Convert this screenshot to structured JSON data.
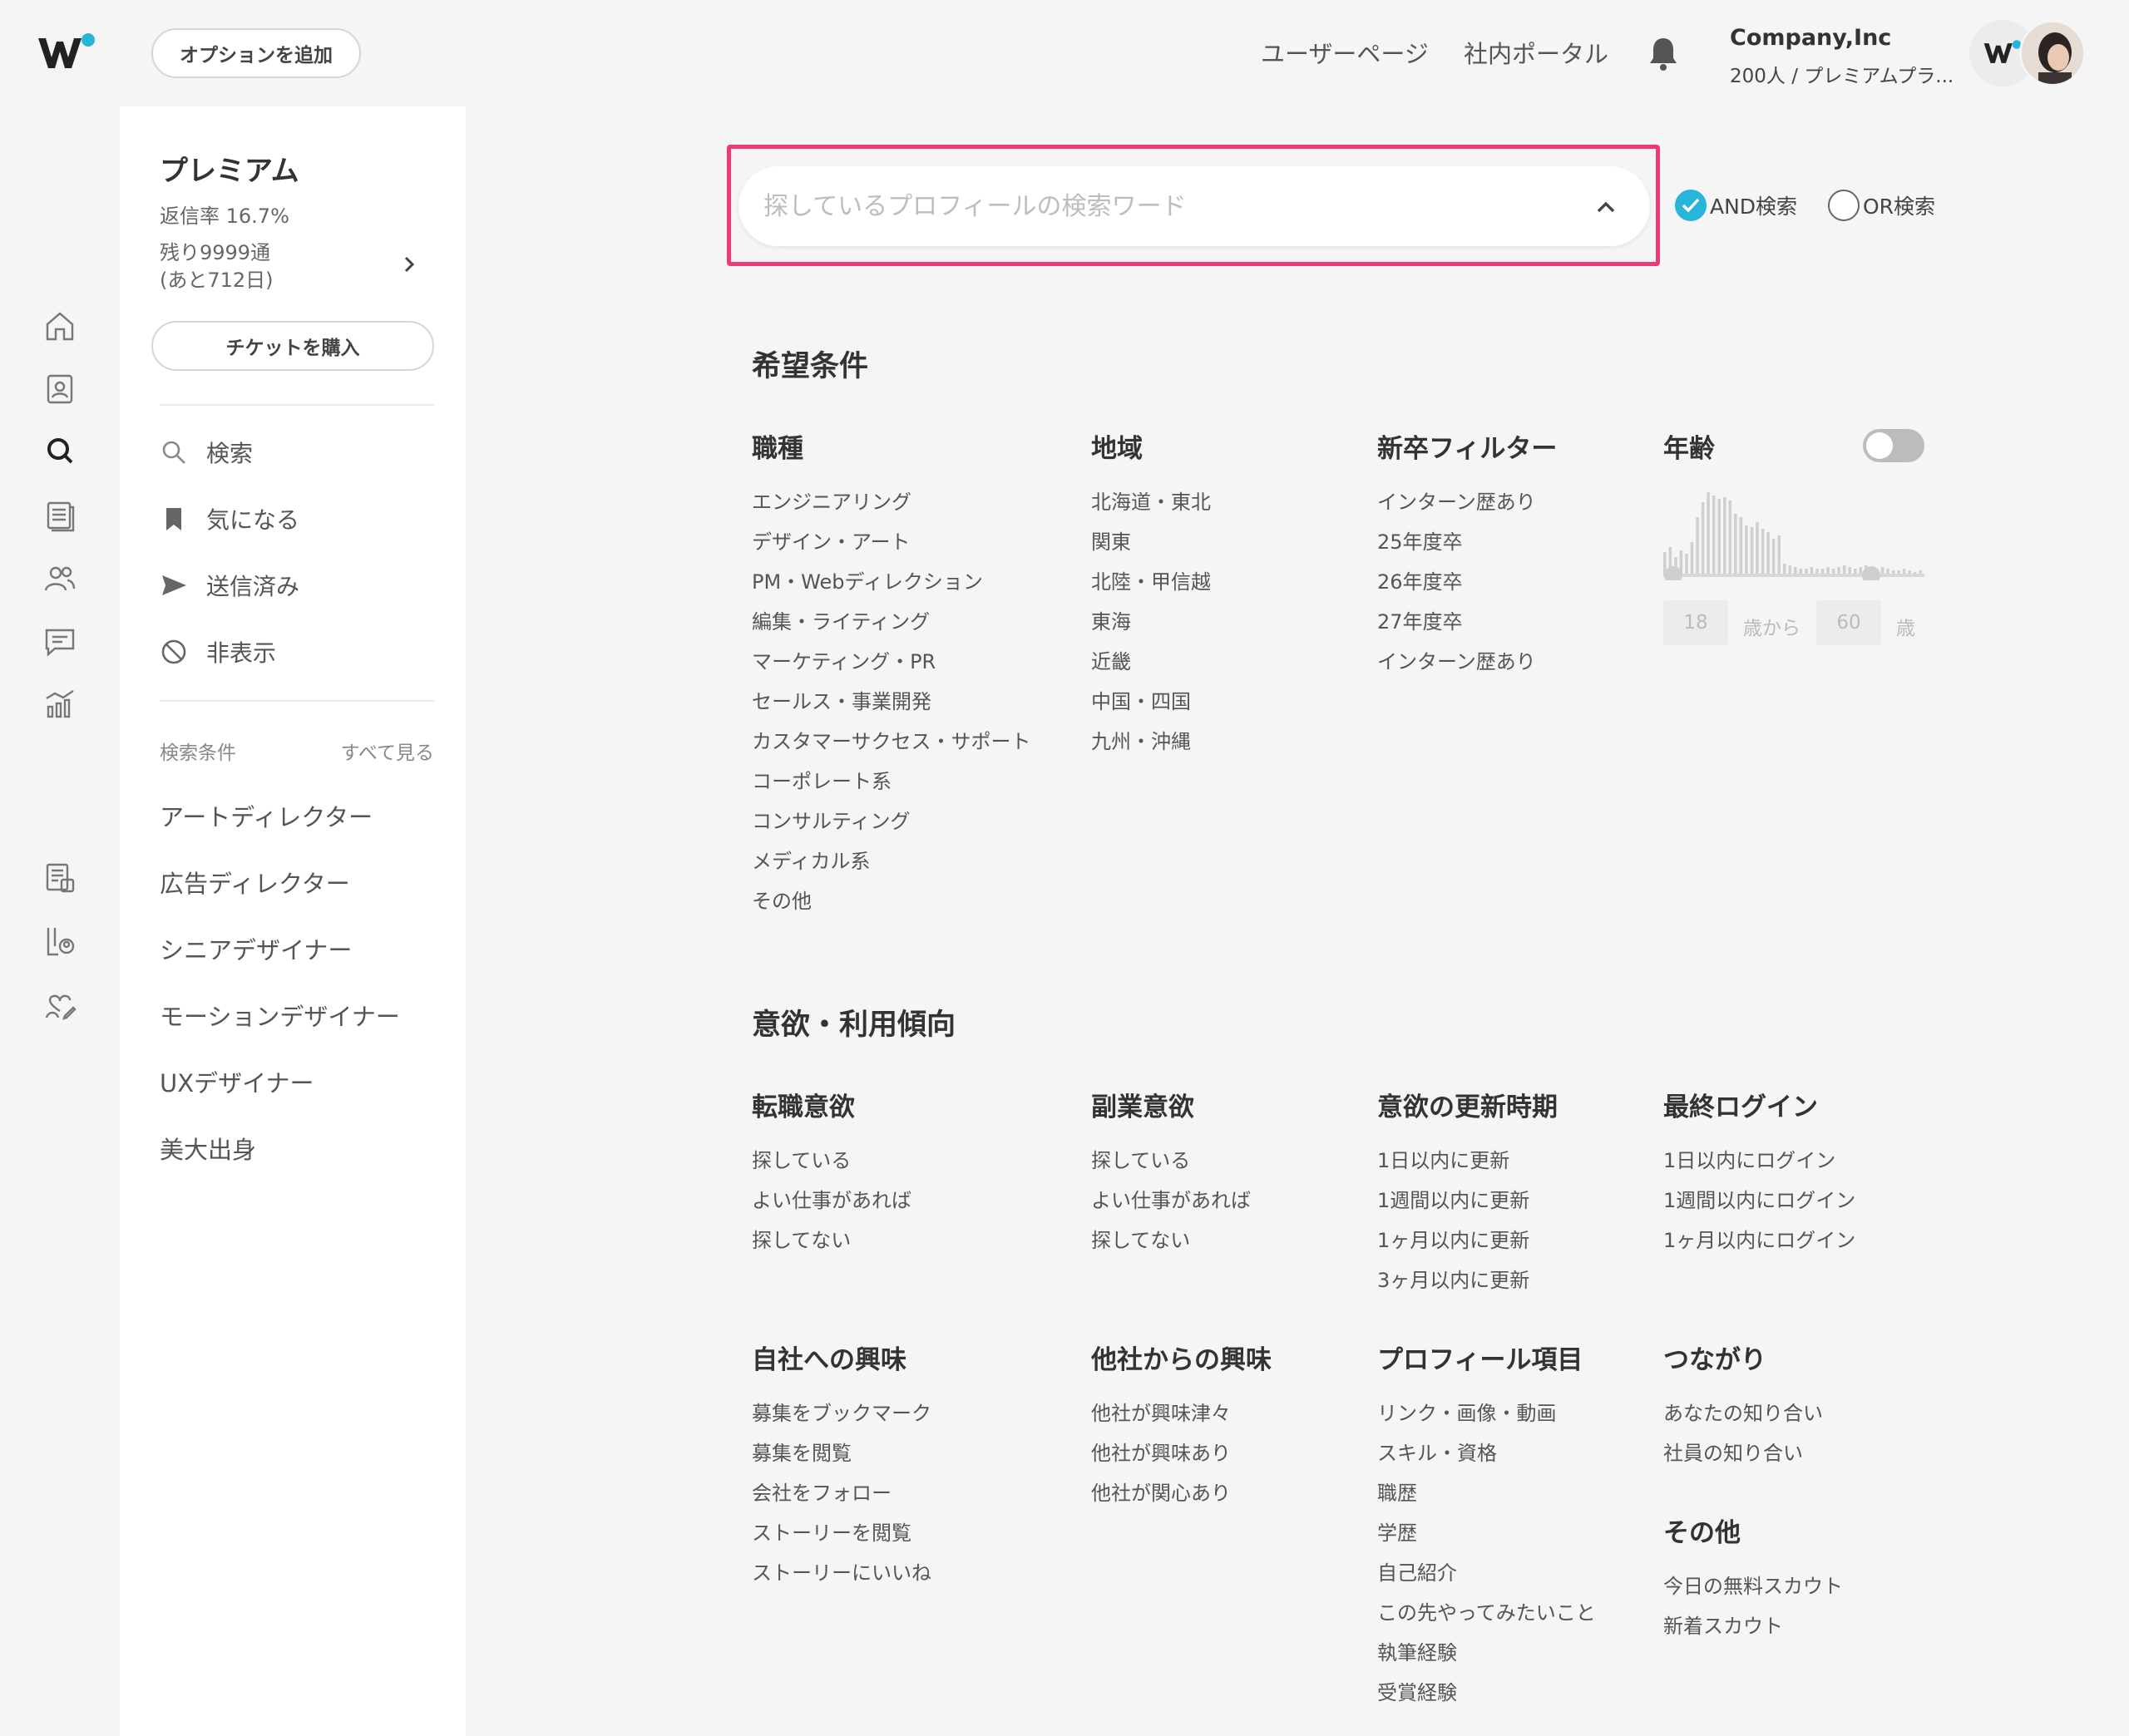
{
  "header": {
    "option_button": "オプションを追加",
    "links": [
      "ユーザーページ",
      "社内ポータル"
    ],
    "company_name": "Company,Inc",
    "company_plan": "200人 / プレミアムプラ..."
  },
  "sidebar": {
    "plan_title": "プレミアム",
    "reply_rate": "返信率 16.7%",
    "remaining_line1": "残り9999通",
    "remaining_line2": "(あと712日)",
    "ticket_button": "チケットを購入",
    "nav": [
      "検索",
      "気になる",
      "送信済み",
      "非表示"
    ],
    "conditions_label": "検索条件",
    "see_all": "すべて見る",
    "conditions": [
      "アートディレクター",
      "広告ディレクター",
      "シニアデザイナー",
      "モーションデザイナー",
      "UXデザイナー",
      "美大出身"
    ]
  },
  "search": {
    "placeholder": "探しているプロフィールの検索ワード",
    "and_label": "AND検索",
    "or_label": "OR検索",
    "mode": "AND"
  },
  "section1": {
    "title": "希望条件",
    "occupation": {
      "title": "職種",
      "items": [
        "エンジニアリング",
        "デザイン・アート",
        "PM・Webディレクション",
        "編集・ライティング",
        "マーケティング・PR",
        "セールス・事業開発",
        "カスタマーサクセス・サポート",
        "コーポレート系",
        "コンサルティング",
        "メディカル系",
        "その他"
      ]
    },
    "region": {
      "title": "地域",
      "items": [
        "北海道・東北",
        "関東",
        "北陸・甲信越",
        "東海",
        "近畿",
        "中国・四国",
        "九州・沖縄"
      ]
    },
    "newgrad": {
      "title": "新卒フィルター",
      "items": [
        "インターン歴あり",
        "25年度卒",
        "26年度卒",
        "27年度卒",
        "インターン歴あり"
      ]
    },
    "age": {
      "title": "年齢",
      "min": "18",
      "from_label": "歳から",
      "max": "60",
      "unit": "歳",
      "enabled": false
    }
  },
  "section2": {
    "title": "意欲・利用傾向",
    "job_change": {
      "title": "転職意欲",
      "items": [
        "探している",
        "よい仕事があれば",
        "探してない"
      ]
    },
    "side_job": {
      "title": "副業意欲",
      "items": [
        "探している",
        "よい仕事があれば",
        "探してない"
      ]
    },
    "update_time": {
      "title": "意欲の更新時期",
      "items": [
        "1日以内に更新",
        "1週間以内に更新",
        "1ヶ月以内に更新",
        "3ヶ月以内に更新"
      ]
    },
    "last_login": {
      "title": "最終ログイン",
      "items": [
        "1日以内にログイン",
        "1週間以内にログイン",
        "1ヶ月以内にログイン"
      ]
    },
    "own_interest": {
      "title": "自社への興味",
      "items": [
        "募集をブックマーク",
        "募集を閲覧",
        "会社をフォロー",
        "ストーリーを閲覧",
        "ストーリーにいいね"
      ]
    },
    "other_interest": {
      "title": "他社からの興味",
      "items": [
        "他社が興味津々",
        "他社が興味あり",
        "他社が関心あり"
      ]
    },
    "profile_items": {
      "title": "プロフィール項目",
      "items": [
        "リンク・画像・動画",
        "スキル・資格",
        "職歴",
        "学歴",
        "自己紹介",
        "この先やってみたいこと",
        "執筆経験",
        "受賞経験"
      ]
    },
    "connections": {
      "title": "つながり",
      "items": [
        "あなたの知り合い",
        "社員の知り合い"
      ]
    },
    "other": {
      "title": "その他",
      "items": [
        "今日の無料スカウト",
        "新着スカウト"
      ]
    }
  }
}
